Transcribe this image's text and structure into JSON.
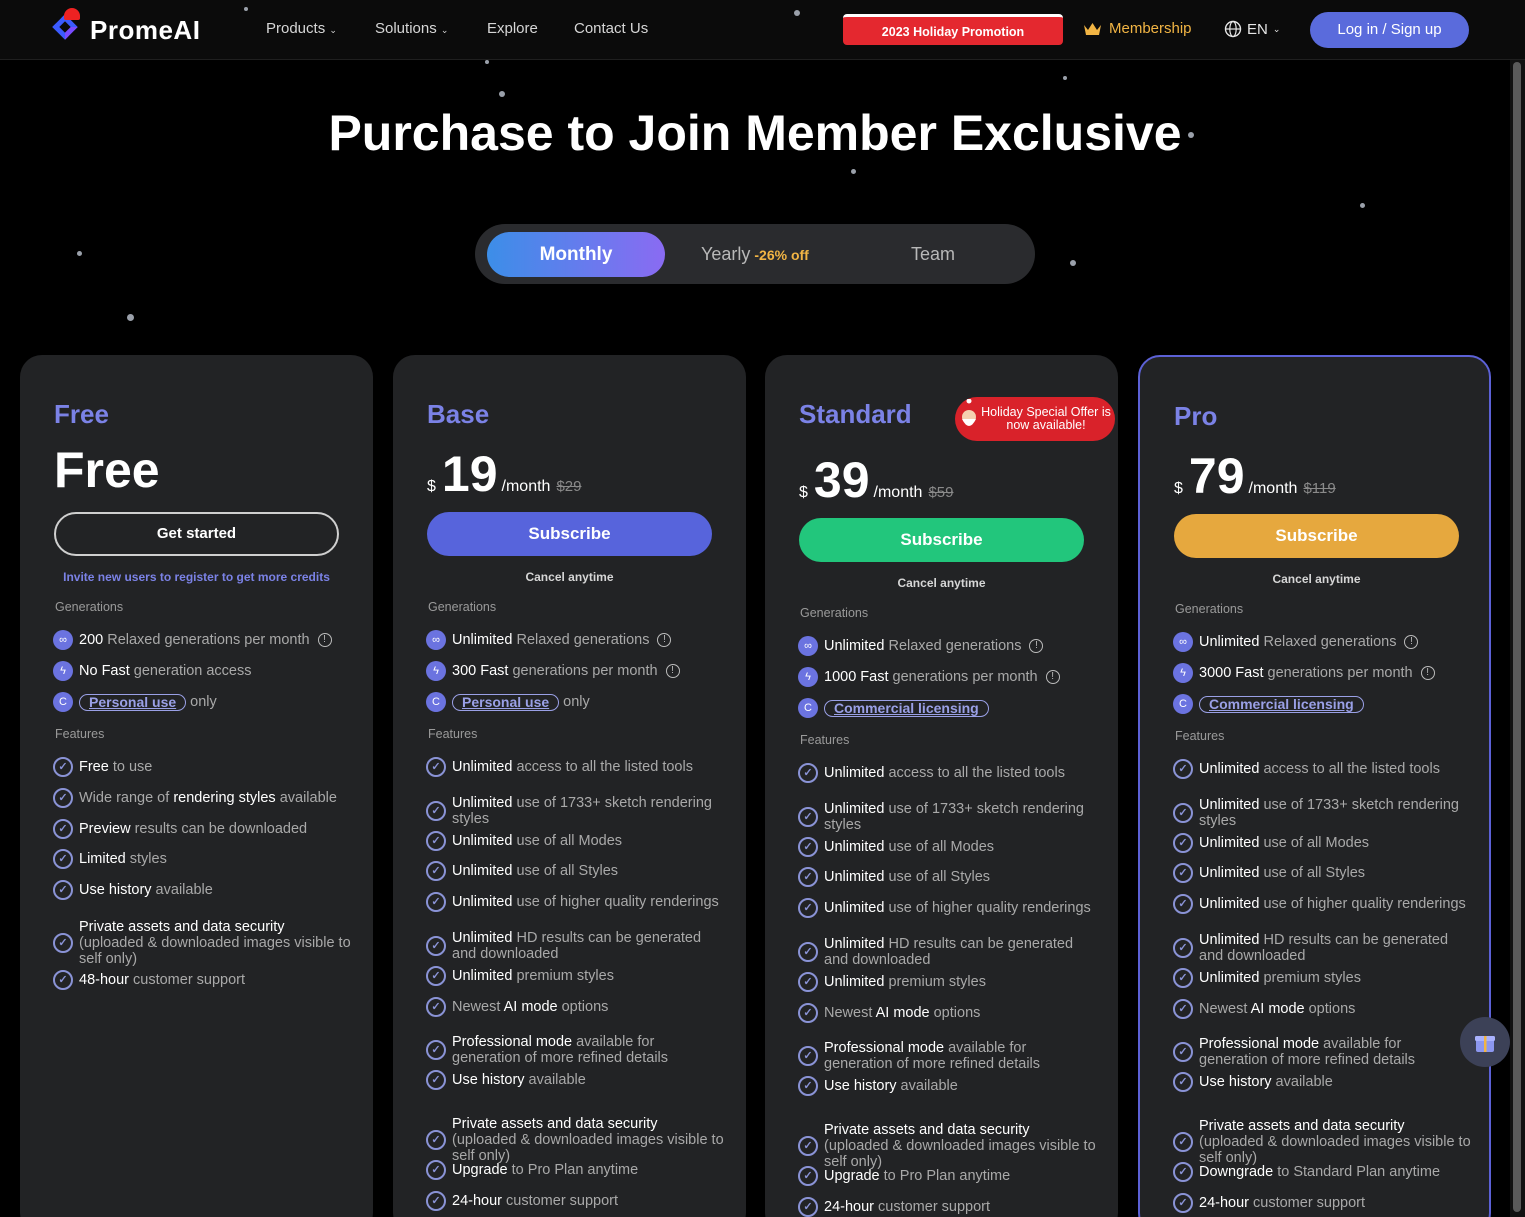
{
  "nav": {
    "logo_text": "PromeAI",
    "menu": [
      {
        "label": "Products",
        "has_dropdown": true
      },
      {
        "label": "Solutions",
        "has_dropdown": true
      },
      {
        "label": "Explore",
        "has_dropdown": false
      },
      {
        "label": "Contact Us",
        "has_dropdown": false
      }
    ],
    "promo_label": "2023 Holiday Promotion",
    "membership_label": "Membership",
    "lang_label": "EN",
    "login_label": "Log in / Sign up"
  },
  "hero": {
    "title": "Purchase to Join Member Exclusive"
  },
  "billing_toggle": {
    "monthly": "Monthly",
    "yearly": "Yearly",
    "yearly_discount": "-26% off",
    "team": "Team",
    "selected": "Monthly"
  },
  "colors": {
    "accent": "#5a6bdc",
    "plan_name": "#7b82e6",
    "base_button": "#5764dc",
    "standard_button": "#22c67c",
    "pro_button": "#e6a83e",
    "promo_red": "#e4282f",
    "membership_gold": "#f2b544"
  },
  "plans": [
    {
      "name": "Free",
      "price_display": "Free",
      "cta": "Get started",
      "note": "Invite new users to register to get more credits",
      "generations_heading": "Generations",
      "generations": [
        {
          "bold": "200",
          "text": " Relaxed generations per month",
          "icon": "infinity-icon",
          "info": true
        },
        {
          "bold": "No Fast",
          "text": " generation access",
          "icon": "bolt-icon",
          "info": false
        },
        {
          "pill": "Personal use",
          "text": "only",
          "icon": "c-icon"
        }
      ],
      "features_heading": "Features",
      "features": [
        {
          "bold": "Free",
          "text": " to use"
        },
        {
          "bold": "",
          "text": "Wide range of ",
          "bold2": "rendering styles",
          "text2": " available"
        },
        {
          "bold": "Preview",
          "text": " results can be downloaded"
        },
        {
          "bold": "Limited",
          "text": " styles"
        },
        {
          "bold": "Use history",
          "text": " available"
        },
        {
          "bold": "Private assets and data security",
          "text": " (uploaded & downloaded images visible to self only)"
        },
        {
          "bold": "48-hour",
          "text": " customer support"
        }
      ]
    },
    {
      "name": "Base",
      "currency": "$",
      "price": "19",
      "per": "/month",
      "old_price": "$29",
      "cta": "Subscribe",
      "note": "Cancel anytime",
      "generations_heading": "Generations",
      "generations": [
        {
          "bold": "Unlimited",
          "text": " Relaxed generations",
          "icon": "infinity-icon",
          "info": true
        },
        {
          "bold": "300 Fast",
          "text": " generations per month",
          "icon": "bolt-icon",
          "info": true
        },
        {
          "pill": "Personal use",
          "text": "only",
          "icon": "c-icon"
        }
      ],
      "features_heading": "Features",
      "features": [
        {
          "bold": "Unlimited",
          "text": " access to all the listed tools"
        },
        {
          "bold": "Unlimited",
          "text": " use of 1733+ sketch rendering styles"
        },
        {
          "bold": "Unlimited",
          "text": " use of all Modes"
        },
        {
          "bold": "Unlimited",
          "text": " use of all Styles"
        },
        {
          "bold": "Unlimited",
          "text": " use of higher quality renderings"
        },
        {
          "bold": "Unlimited",
          "text": " HD results can be generated and downloaded"
        },
        {
          "bold": "Unlimited",
          "text": " premium styles"
        },
        {
          "bold": "",
          "text": "Newest ",
          "bold2": "AI mode",
          "text2": " options"
        },
        {
          "bold": "Professional mode",
          "text": " available for generation of more refined details"
        },
        {
          "bold": "Use history",
          "text": " available"
        },
        {
          "bold": "Private assets and data security",
          "text": " (uploaded & downloaded images visible to self only)"
        },
        {
          "bold": "Upgrade",
          "text": " to Pro Plan anytime"
        },
        {
          "bold": "24-hour",
          "text": " customer support"
        }
      ]
    },
    {
      "name": "Standard",
      "currency": "$",
      "price": "39",
      "per": "/month",
      "old_price": "$59",
      "cta": "Subscribe",
      "note": "Cancel anytime",
      "badge": "Holiday Special Offer is now available!",
      "generations_heading": "Generations",
      "generations": [
        {
          "bold": "Unlimited",
          "text": " Relaxed generations",
          "icon": "infinity-icon",
          "info": true
        },
        {
          "bold": "1000 Fast",
          "text": " generations per month",
          "icon": "bolt-icon",
          "info": true
        },
        {
          "pill": "Commercial licensing",
          "text": "",
          "icon": "c-icon"
        }
      ],
      "features_heading": "Features",
      "features": [
        {
          "bold": "Unlimited",
          "text": " access to all the listed tools"
        },
        {
          "bold": "Unlimited",
          "text": " use of 1733+ sketch rendering styles"
        },
        {
          "bold": "Unlimited",
          "text": " use of all Modes"
        },
        {
          "bold": "Unlimited",
          "text": " use of all Styles"
        },
        {
          "bold": "Unlimited",
          "text": " use of higher quality renderings"
        },
        {
          "bold": "Unlimited",
          "text": " HD results can be generated and downloaded"
        },
        {
          "bold": "Unlimited",
          "text": " premium styles"
        },
        {
          "bold": "",
          "text": "Newest ",
          "bold2": "AI mode",
          "text2": " options"
        },
        {
          "bold": "Professional mode",
          "text": " available for generation of more refined details"
        },
        {
          "bold": "Use history",
          "text": " available"
        },
        {
          "bold": "Private assets and data security",
          "text": " (uploaded & downloaded images visible to self only)"
        },
        {
          "bold": "Upgrade",
          "text": " to Pro Plan anytime"
        },
        {
          "bold": "24-hour",
          "text": " customer support"
        }
      ]
    },
    {
      "name": "Pro",
      "currency": "$",
      "price": "79",
      "per": "/month",
      "old_price": "$119",
      "cta": "Subscribe",
      "note": "Cancel anytime",
      "generations_heading": "Generations",
      "generations": [
        {
          "bold": "Unlimited",
          "text": " Relaxed generations",
          "icon": "infinity-icon",
          "info": true
        },
        {
          "bold": "3000 Fast",
          "text": " generations per month",
          "icon": "bolt-icon",
          "info": true
        },
        {
          "pill": "Commercial licensing",
          "text": "",
          "icon": "c-icon"
        }
      ],
      "features_heading": "Features",
      "features": [
        {
          "bold": "Unlimited",
          "text": " access to all the listed tools"
        },
        {
          "bold": "Unlimited",
          "text": " use of 1733+ sketch rendering styles"
        },
        {
          "bold": "Unlimited",
          "text": " use of all Modes"
        },
        {
          "bold": "Unlimited",
          "text": " use of all Styles"
        },
        {
          "bold": "Unlimited",
          "text": " use of higher quality renderings"
        },
        {
          "bold": "Unlimited",
          "text": " HD results can be generated and downloaded"
        },
        {
          "bold": "Unlimited",
          "text": " premium styles"
        },
        {
          "bold": "",
          "text": "Newest ",
          "bold2": "AI mode",
          "text2": " options"
        },
        {
          "bold": "Professional mode",
          "text": " available for generation of more refined details"
        },
        {
          "bold": "Use history",
          "text": " available"
        },
        {
          "bold": "Private assets and data security",
          "text": " (uploaded & downloaded images visible to self only)"
        },
        {
          "bold": "Downgrade",
          "text": " to Standard Plan anytime"
        },
        {
          "bold": "24-hour",
          "text": " customer support"
        }
      ]
    }
  ],
  "floating": {
    "gift_icon": "gift-icon"
  }
}
